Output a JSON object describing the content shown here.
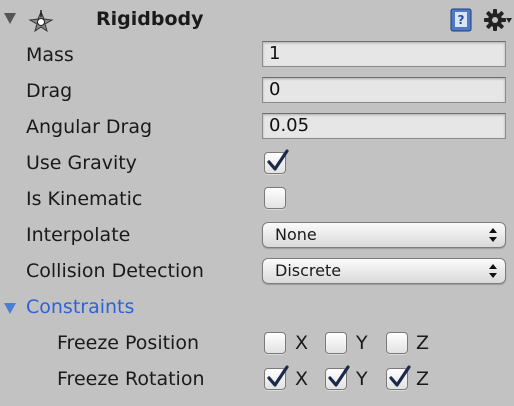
{
  "component": {
    "title": "Rigidbody",
    "icons": {
      "foldout": "foldout-triangle-icon",
      "component": "rigidbody-icon",
      "help": "help-book-icon",
      "settings": "gear-icon"
    }
  },
  "fields": {
    "mass": {
      "label": "Mass",
      "value": "1"
    },
    "drag": {
      "label": "Drag",
      "value": "0"
    },
    "angular_drag": {
      "label": "Angular Drag",
      "value": "0.05"
    },
    "use_gravity": {
      "label": "Use Gravity",
      "checked": true
    },
    "is_kinematic": {
      "label": "Is Kinematic",
      "checked": false
    },
    "interpolate": {
      "label": "Interpolate",
      "value": "None"
    },
    "collision_detection": {
      "label": "Collision Detection",
      "value": "Discrete"
    }
  },
  "constraints": {
    "label": "Constraints",
    "freeze_position": {
      "label": "Freeze Position",
      "x": "X",
      "y": "Y",
      "z": "Z",
      "x_checked": false,
      "y_checked": false,
      "z_checked": false
    },
    "freeze_rotation": {
      "label": "Freeze Rotation",
      "x": "X",
      "y": "Y",
      "z": "Z",
      "x_checked": true,
      "y_checked": true,
      "z_checked": true
    }
  },
  "colors": {
    "background": "#c2c2c2",
    "constraints_accent": "#2d63d6"
  }
}
